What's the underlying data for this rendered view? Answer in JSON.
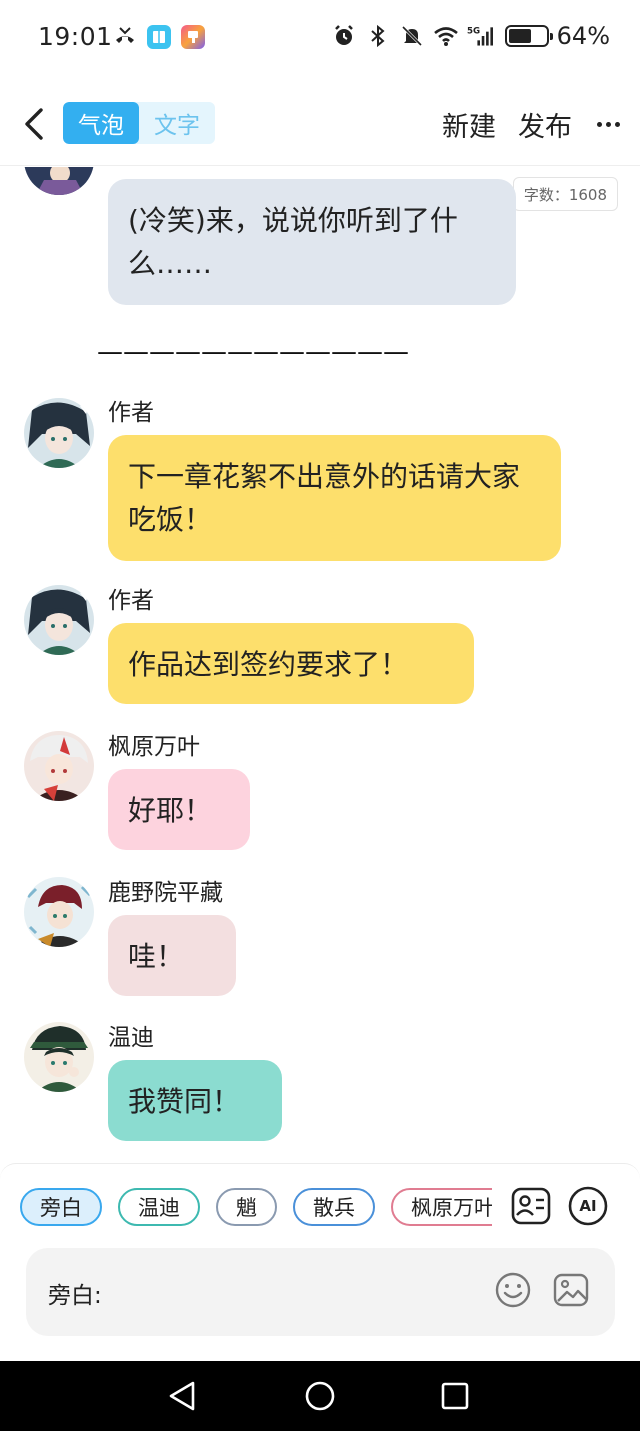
{
  "status_bar": {
    "time": "19:01",
    "battery_percent": "64%",
    "battery_level": 0.64
  },
  "top_bar": {
    "mode_tabs": [
      "气泡",
      "文字"
    ],
    "new_label": "新建",
    "publish_label": "发布"
  },
  "chat": {
    "word_count": "字数：1608",
    "divider": "————————————",
    "messages": [
      {
        "speaker": "",
        "text": "(冷笑)来，说说你听到了什么……",
        "bubble_color": "#e0e6ee"
      },
      {
        "speaker": "作者",
        "text": "下一章花絮不出意外的话请大家吃饭！",
        "bubble_color": "#fddf6c"
      },
      {
        "speaker": "作者",
        "text": "作品达到签约要求了！",
        "bubble_color": "#fddf6c"
      },
      {
        "speaker": "枫原万叶",
        "text": "好耶！",
        "bubble_color": "#fdd3de"
      },
      {
        "speaker": "鹿野院平藏",
        "text": "哇！",
        "bubble_color": "#f3dfe0"
      },
      {
        "speaker": "温迪",
        "text": "我赞同！",
        "bubble_color": "#8bdcd0"
      }
    ]
  },
  "composer": {
    "chips": [
      "旁白",
      "温迪",
      "魈",
      "散兵",
      "枫原万叶"
    ],
    "input_label": "旁白:",
    "input_value": "",
    "ai_label": "AI"
  },
  "colors": {
    "accent": "#33aff0",
    "author_bubble": "#fddf6c",
    "venti_bubble": "#8bdcd0"
  },
  "icons": [
    "back-arrow-icon",
    "more-dots-icon",
    "character-card-icon",
    "ai-icon",
    "emoji-icon",
    "image-icon",
    "nav-back-icon",
    "nav-home-icon",
    "nav-recents-icon"
  ]
}
